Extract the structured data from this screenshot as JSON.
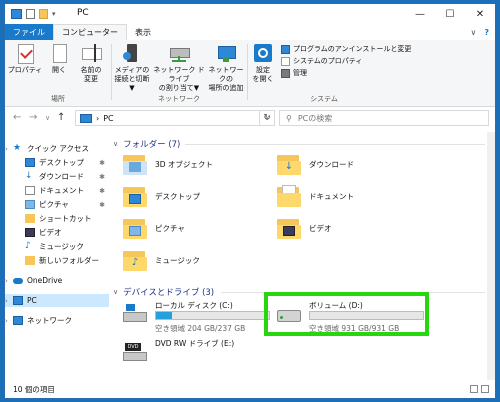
{
  "window": {
    "title": "PC",
    "controls": [
      "—",
      "☐",
      "✕"
    ]
  },
  "ribbon_tabs": [
    "ファイル",
    "コンピューター",
    "表示"
  ],
  "ribbon_right": {
    "collapse": "∨",
    "help": "?"
  },
  "ribbon": {
    "location_group": {
      "label": "場所",
      "buttons": [
        {
          "label1": "プロパティ",
          "label2": ""
        },
        {
          "label1": "開く",
          "label2": ""
        },
        {
          "label1": "名前の",
          "label2": "変更"
        }
      ]
    },
    "network_group": {
      "label": "ネットワーク",
      "buttons": [
        {
          "label1": "メディアの",
          "label2": "接続と切断▼"
        },
        {
          "label1": "ネットワーク ドライブ",
          "label2": "の割り当て▼"
        },
        {
          "label1": "ネットワークの",
          "label2": "場所の追加"
        }
      ]
    },
    "system_group": {
      "label": "システム",
      "open_settings": {
        "label1": "設定",
        "label2": "を開く"
      },
      "items": [
        "プログラムのアンインストールと変更",
        "システムのプロパティ",
        "管理"
      ]
    }
  },
  "nav_buttons": {
    "back": "←",
    "forward": "→",
    "recent": "∨",
    "up": "↑"
  },
  "address": {
    "path_sep": "›",
    "path": "PC",
    "dropdown": "∨"
  },
  "refresh_glyph": "↻",
  "search": {
    "icon": "⚲",
    "placeholder": "PCの検索"
  },
  "nav_pane": {
    "quick_access": "クイック アクセス",
    "items": [
      "デスクトップ",
      "ダウンロード",
      "ドキュメント",
      "ピクチャ",
      "ショートカット",
      "ビデオ",
      "ミュージック",
      "新しいフォルダー"
    ],
    "onedrive": "OneDrive",
    "pc": "PC",
    "network": "ネットワーク",
    "pin": "✱",
    "expand": "›"
  },
  "content": {
    "folders_header": "フォルダー (7)",
    "folders": [
      "3D オブジェクト",
      "ダウンロード",
      "デスクトップ",
      "ドキュメント",
      "ピクチャ",
      "ビデオ",
      "ミュージック"
    ],
    "drives_header": "デバイスとドライブ (3)",
    "chevron": "∨",
    "drives": [
      {
        "name": "ローカル ディスク (C:)",
        "free": "空き領域 204 GB/237 GB",
        "used_fraction": 0.14
      },
      {
        "name": "ボリューム (D:)",
        "free": "空き領域 931 GB/931 GB",
        "used_fraction": 0.0
      },
      {
        "name": "DVD RW ドライブ (E:)",
        "free": "",
        "badge": "DVD"
      }
    ]
  },
  "status": {
    "items": "10 個の項目"
  },
  "colors": {
    "accent": "#1979ca",
    "highlight": "#27d60f",
    "bar_fill": "#26a0da",
    "folder": "#f6c65b"
  }
}
